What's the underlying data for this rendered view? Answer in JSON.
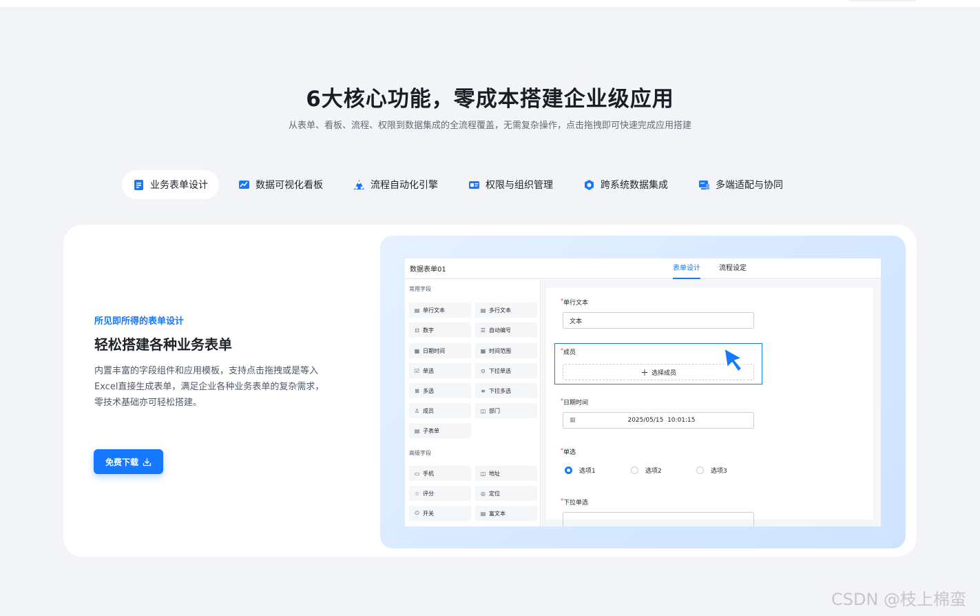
{
  "section": {
    "title": "6大核心功能，零成本搭建企业级应用",
    "subtitle": "从表单、看板、流程、权限到数据集成的全流程覆盖，无需复杂操作，点击拖拽即可快速完成应用搭建"
  },
  "tabs": [
    {
      "label": "业务表单设计",
      "icon": "form-icon",
      "active": true
    },
    {
      "label": "数据可视化看板",
      "icon": "chart-board-icon",
      "active": false
    },
    {
      "label": "流程自动化引擎",
      "icon": "workflow-icon",
      "active": false
    },
    {
      "label": "权限与组织管理",
      "icon": "id-card-icon",
      "active": false
    },
    {
      "label": "跨系统数据集成",
      "icon": "integration-icon",
      "active": false
    },
    {
      "label": "多端适配与协同",
      "icon": "devices-icon",
      "active": false
    }
  ],
  "feature": {
    "eyebrow": "所见即所得的表单设计",
    "heading": "轻松搭建各种业务表单",
    "description": "内置丰富的字段组件和应用模板，支持点击拖拽或是等入Excel直接生成表单，满足企业各种业务表单的复杂需求，零技术基础亦可轻松搭建。",
    "download_label": "免费下载"
  },
  "mock": {
    "form_name": "数据表单01",
    "tabs": [
      "表单设计",
      "流程设定"
    ],
    "common_group": "常用字段",
    "common_fields": [
      {
        "label": "单行文本",
        "icon": "text-line-icon"
      },
      {
        "label": "多行文本",
        "icon": "text-multi-icon"
      },
      {
        "label": "数字",
        "icon": "number-icon"
      },
      {
        "label": "自动编号",
        "icon": "auto-number-icon"
      },
      {
        "label": "日期时间",
        "icon": "calendar-icon"
      },
      {
        "label": "时间范围",
        "icon": "time-range-icon"
      },
      {
        "label": "单选",
        "icon": "checkbox-icon"
      },
      {
        "label": "下拉单选",
        "icon": "dropdown-icon"
      },
      {
        "label": "多选",
        "icon": "multi-check-icon"
      },
      {
        "label": "下拉多选",
        "icon": "dropdown-multi-icon"
      },
      {
        "label": "成员",
        "icon": "user-icon"
      },
      {
        "label": "部门",
        "icon": "department-icon"
      },
      {
        "label": "子表单",
        "icon": "subform-icon"
      }
    ],
    "advanced_group": "高级字段",
    "advanced_fields": [
      {
        "label": "手机",
        "icon": "phone-icon"
      },
      {
        "label": "地址",
        "icon": "address-icon"
      },
      {
        "label": "评分",
        "icon": "star-icon"
      },
      {
        "label": "定位",
        "icon": "location-icon"
      },
      {
        "label": "开关",
        "icon": "power-icon"
      },
      {
        "label": "富文本",
        "icon": "rich-text-icon"
      }
    ],
    "form": {
      "text_label": "单行文本",
      "text_value": "文本",
      "member_label": "成员",
      "member_button": "选择成员",
      "datetime_label": "日期时间",
      "datetime_value": "2025/05/15  10:01:15",
      "radio_label": "单选",
      "radio_options": [
        "选项1",
        "选项2",
        "选项3"
      ],
      "radio_selected": 0,
      "dropdown_label": "下拉单选"
    }
  },
  "watermark": "CSDN @枝上棉蛮",
  "colors": {
    "accent": "#1677ff",
    "background": "#f3f4f7",
    "preview_bg": "#d6e8ff"
  }
}
